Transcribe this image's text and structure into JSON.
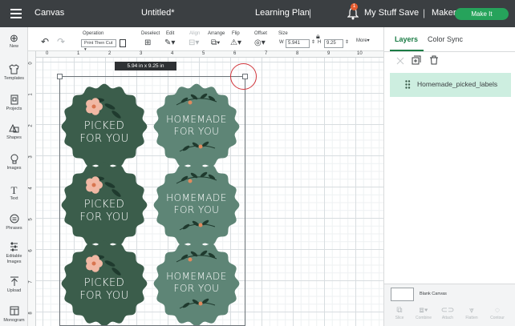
{
  "topbar": {
    "canvas_label": "Canvas",
    "doc_title": "Untitled*",
    "learning_plan": "Learning Plan",
    "sep": "|",
    "notification_count": "1",
    "my_stuff": "My Stuff",
    "save": "Save",
    "maker": "Maker",
    "maker_chevron": "⌄",
    "make_it": "Make It"
  },
  "toolbar": {
    "operation_label": "Operation",
    "operation_value": "Print Then Cut ▾",
    "deselect_label": "Deselect",
    "edit_label": "Edit",
    "align_label": "Align",
    "arrange_label": "Arrange",
    "flip_label": "Flip",
    "offset_label": "Offset",
    "size_label": "Size",
    "w_label": "W",
    "w_value": "5.941",
    "h_label": "H",
    "h_value": "9.25",
    "more_label": "More▾"
  },
  "sidebar": {
    "items": [
      {
        "label": "New",
        "icon": "plus-circle-icon"
      },
      {
        "label": "Templates",
        "icon": "shirt-icon"
      },
      {
        "label": "Projects",
        "icon": "projects-icon"
      },
      {
        "label": "Shapes",
        "icon": "shapes-icon"
      },
      {
        "label": "Images",
        "icon": "lightbulb-icon"
      },
      {
        "label": "Text",
        "icon": "text-icon"
      },
      {
        "label": "Phrases",
        "icon": "speech-bubble-icon"
      },
      {
        "label": "Editable Images",
        "icon": "editable-images-icon"
      },
      {
        "label": "Upload",
        "icon": "upload-icon"
      },
      {
        "label": "Monogram",
        "icon": "monogram-icon"
      }
    ]
  },
  "canvas": {
    "size_tooltip": "5.94  in x 9.25  in",
    "ruler_top": [
      "0",
      "1",
      "2",
      "3",
      "4",
      "5",
      "6",
      "7",
      "8",
      "9",
      "10"
    ],
    "ruler_left": [
      "0",
      "1",
      "2",
      "3",
      "4",
      "5",
      "6",
      "7",
      "8"
    ],
    "labels": [
      {
        "line1": "PICKED",
        "line2": "FOR YOU",
        "color": "#3b5d4b"
      },
      {
        "line1": "HOMEMADE",
        "line2": "FOR YOU",
        "color": "#5e8576"
      }
    ]
  },
  "right_panel": {
    "tabs": [
      "Layers",
      "Color Sync"
    ],
    "layer_name": "Homemade_picked_labels",
    "blank_canvas": "Blank Canvas",
    "bottom_tools": [
      "Slice",
      "Combine",
      "Attach",
      "Flatten",
      "Contour"
    ]
  },
  "colors": {
    "topbar": "#3b3f42",
    "make_it": "#26a35b",
    "active_tab": "#1b7c45",
    "layer_highlight": "#cdeee0",
    "annotation_circle": "#d0343a"
  }
}
